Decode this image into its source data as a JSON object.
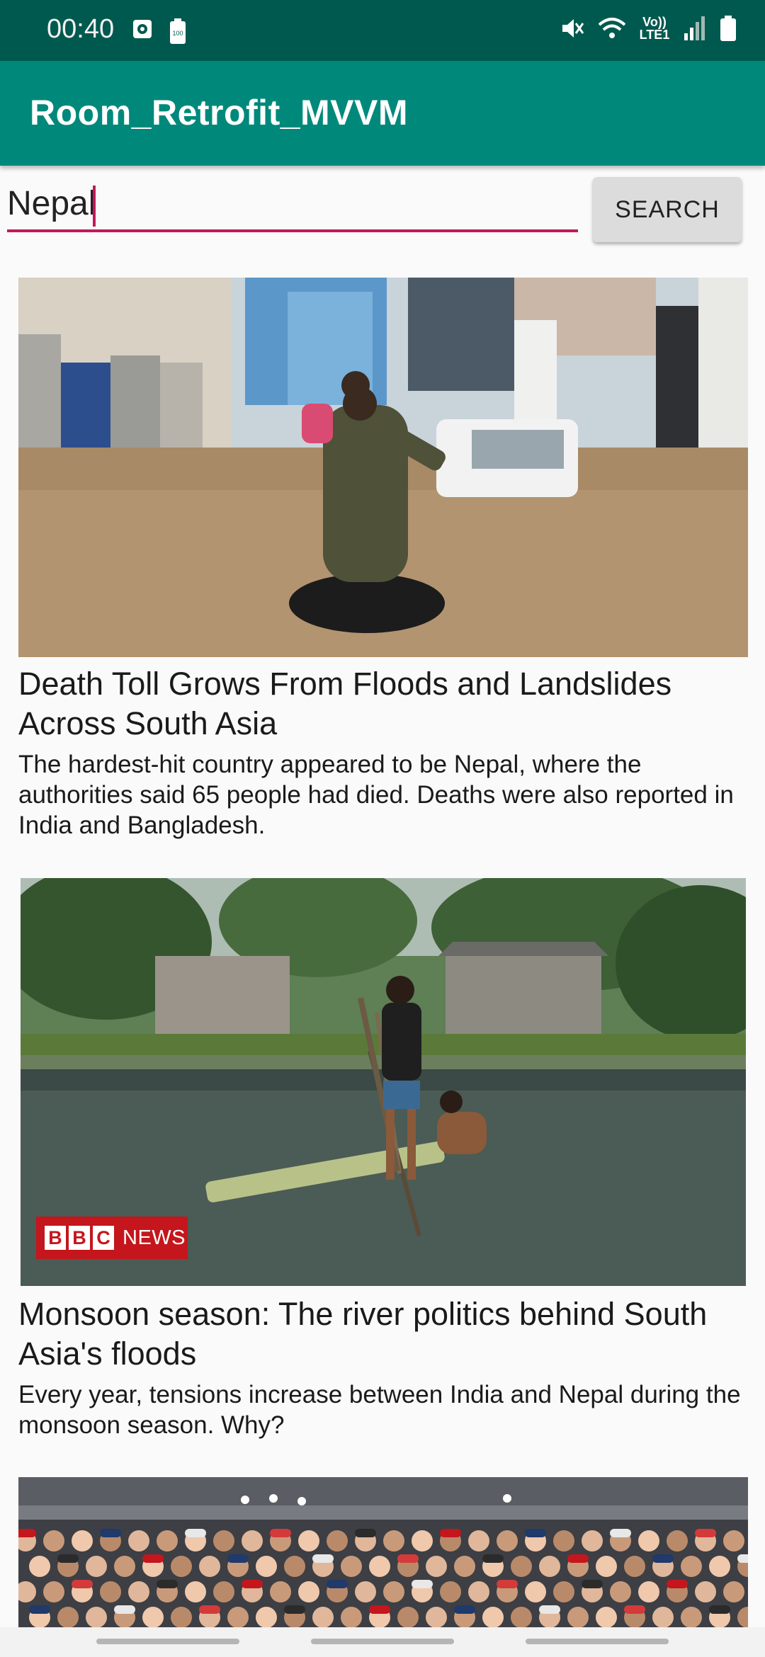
{
  "status_bar": {
    "time": "00:40",
    "volte_label": "Vo)) LTE1",
    "icons": [
      "clock-icon",
      "battery-saver-icon",
      "mute-icon",
      "wifi-icon",
      "volte-icon",
      "signal-icon",
      "battery-icon"
    ]
  },
  "app_bar": {
    "title": "Room_Retrofit_MVVM"
  },
  "search": {
    "value": "Nepal",
    "button_label": "SEARCH"
  },
  "articles": [
    {
      "title": "Death Toll Grows From Floods and Landslides Across South Asia",
      "description": "The hardest-hit country appeared to be Nepal, where the authorities said 65 people had died. Deaths were also reported in India and Bangladesh."
    },
    {
      "title": "Monsoon season: The river politics behind South Asia's floods",
      "description": "Every year, tensions increase between India and Nepal during the monsoon season. Why?",
      "logo_text": [
        "B",
        "B",
        "C",
        "NEWS"
      ]
    },
    {
      "title": "",
      "description": ""
    }
  ],
  "colors": {
    "status_bar": "#00594f",
    "app_bar": "#00897b",
    "accent": "#c2185b",
    "button": "#dcdcdc"
  }
}
